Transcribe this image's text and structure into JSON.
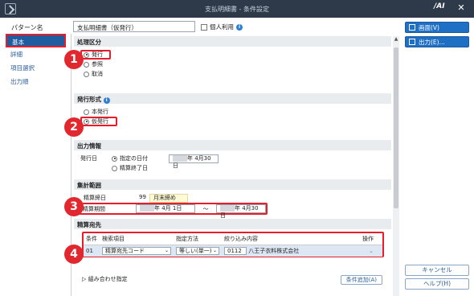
{
  "window": {
    "title": "支払明細書 - 条件設定"
  },
  "pattern": {
    "label": "パターン名",
    "value": "支払明細書（仮発行）",
    "personal_label": "個人利用"
  },
  "sidebar": {
    "items": [
      {
        "label": "基本"
      },
      {
        "label": "詳細"
      },
      {
        "label": "項目選択"
      },
      {
        "label": "出力順"
      }
    ]
  },
  "sections": {
    "issue": {
      "title": "処理区分",
      "options": [
        "発行",
        "参照",
        "取消"
      ],
      "selected": "発行"
    },
    "format": {
      "title": "発行形式",
      "options": [
        "本発行",
        "仮発行"
      ],
      "selected": "仮発行"
    },
    "output": {
      "title": "出力情報",
      "date_label": "発行日",
      "opt1": "指定の日付",
      "opt2": "精算終了日",
      "date_value": "年  4月30日"
    },
    "range": {
      "title": "集計範囲",
      "close_label": "精算締日",
      "close_value": "99",
      "close_text": "月末締め",
      "period_label": "精算期間",
      "from": "年  4月  1日",
      "tilde": "〜",
      "to": "年  4月30日"
    },
    "dest": {
      "title": "精算宛先",
      "headers": [
        "条件",
        "検索項目",
        "指定方法",
        "絞り込み内容",
        "操作"
      ],
      "row": {
        "no": "01",
        "field": "精算宛先コード",
        "method": "等しい(単一)",
        "code": "0112",
        "name": "八王子衣料株式会社"
      },
      "footer": "組み合わせ指定",
      "footer_btn": "条件追加(A)"
    }
  },
  "buttons": {
    "preview": "画面(V)",
    "output": "出力(E)...",
    "cancel": "キャンセル",
    "help": "ヘルプ(H)"
  },
  "badges": [
    "1",
    "2",
    "3",
    "4"
  ],
  "colors": {
    "accent": "#1f6fc5",
    "badge": "#e0282e"
  }
}
